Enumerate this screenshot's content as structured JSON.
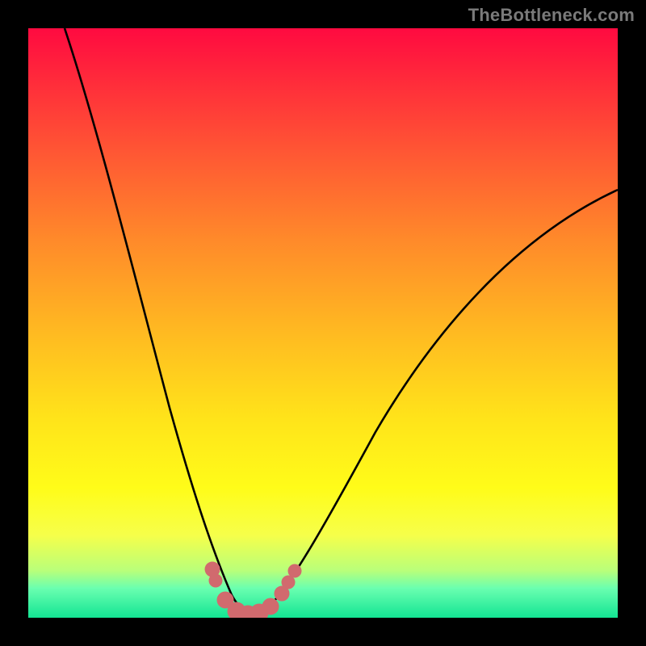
{
  "watermark_text": "TheBottleneck.com",
  "colors": {
    "bg": "#000000",
    "watermark": "#7a7a7a",
    "curve": "#000000",
    "marker": "#d16a6e",
    "gradient_stops": [
      {
        "pos": 0,
        "hex": "#ff0a40"
      },
      {
        "pos": 10,
        "hex": "#ff2f3a"
      },
      {
        "pos": 22,
        "hex": "#ff5a33"
      },
      {
        "pos": 36,
        "hex": "#ff8a2a"
      },
      {
        "pos": 50,
        "hex": "#ffb522"
      },
      {
        "pos": 66,
        "hex": "#ffe31a"
      },
      {
        "pos": 78,
        "hex": "#fffc19"
      },
      {
        "pos": 86,
        "hex": "#f6ff4a"
      },
      {
        "pos": 92,
        "hex": "#b9ff7a"
      },
      {
        "pos": 95,
        "hex": "#6affb0"
      },
      {
        "pos": 100,
        "hex": "#13e493"
      }
    ]
  },
  "chart_data": {
    "type": "line",
    "title": "",
    "xlabel": "",
    "ylabel": "",
    "xlim": [
      0,
      100
    ],
    "ylim": [
      0,
      100
    ],
    "series": [
      {
        "name": "bottleneck-curve",
        "x": [
          0,
          5,
          10,
          15,
          20,
          25,
          28,
          30,
          32,
          34,
          36,
          38,
          40,
          45,
          50,
          55,
          60,
          65,
          70,
          75,
          80,
          85,
          90,
          95,
          100
        ],
        "values": [
          100,
          88,
          76,
          62,
          48,
          32,
          22,
          15,
          9,
          5,
          3,
          3,
          5,
          12,
          20,
          28,
          34,
          40,
          45,
          50,
          54,
          58,
          62,
          65,
          66
        ]
      }
    ],
    "markers": {
      "name": "highlighted-points",
      "x": [
        28,
        30,
        32,
        34,
        36,
        38,
        40,
        42,
        44
      ],
      "values": [
        22,
        15,
        9,
        5,
        3,
        3,
        5,
        8,
        12
      ]
    }
  }
}
